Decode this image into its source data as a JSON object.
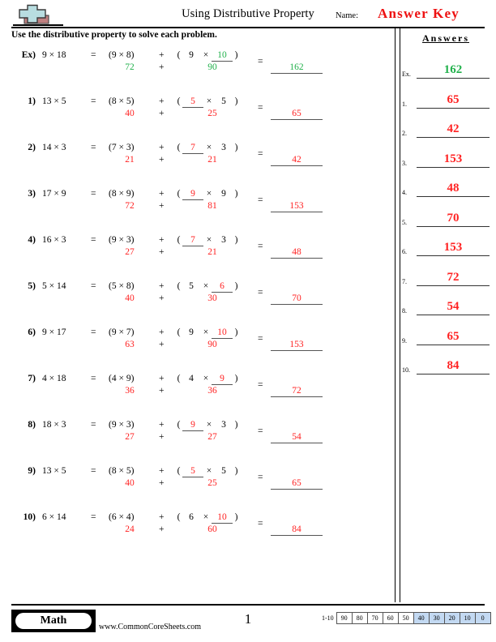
{
  "header": {
    "title": "Using Distributive Property",
    "name_label": "Name:",
    "answer_key": "Answer Key",
    "logo_icon": "plus-block-logo"
  },
  "instructions": "Use the distributive property to solve each problem.",
  "answers_panel": {
    "title": "Answers",
    "rows": [
      {
        "label": "Ex.",
        "value": "162",
        "color": "#22b14c"
      },
      {
        "label": "1.",
        "value": "65",
        "color": "#ff2222"
      },
      {
        "label": "2.",
        "value": "42",
        "color": "#ff2222"
      },
      {
        "label": "3.",
        "value": "153",
        "color": "#ff2222"
      },
      {
        "label": "4.",
        "value": "48",
        "color": "#ff2222"
      },
      {
        "label": "5.",
        "value": "70",
        "color": "#ff2222"
      },
      {
        "label": "6.",
        "value": "153",
        "color": "#ff2222"
      },
      {
        "label": "7.",
        "value": "72",
        "color": "#ff2222"
      },
      {
        "label": "8.",
        "value": "54",
        "color": "#ff2222"
      },
      {
        "label": "9.",
        "value": "65",
        "color": "#ff2222"
      },
      {
        "label": "10.",
        "value": "84",
        "color": "#ff2222"
      }
    ]
  },
  "problems": [
    {
      "number": "Ex)",
      "ink": "#22b14c",
      "expression": "9 × 18",
      "equals": "=",
      "group1": "(9 × 8)",
      "plus": "+",
      "group2": {
        "open": "(",
        "left": "9",
        "times": "×",
        "right": "10",
        "close": ")",
        "blank_side": "right"
      },
      "partial1": "72",
      "plus2": "+",
      "partial2": "90",
      "equals2": "=",
      "total": "162"
    },
    {
      "number": "1)",
      "ink": "#ff2222",
      "expression": "13 × 5",
      "equals": "=",
      "group1": "(8 × 5)",
      "plus": "+",
      "group2": {
        "open": "(",
        "left": "5",
        "times": "×",
        "right": "5",
        "close": ")",
        "blank_side": "left"
      },
      "partial1": "40",
      "plus2": "+",
      "partial2": "25",
      "equals2": "=",
      "total": "65"
    },
    {
      "number": "2)",
      "ink": "#ff2222",
      "expression": "14 × 3",
      "equals": "=",
      "group1": "(7 × 3)",
      "plus": "+",
      "group2": {
        "open": "(",
        "left": "7",
        "times": "×",
        "right": "3",
        "close": ")",
        "blank_side": "left"
      },
      "partial1": "21",
      "plus2": "+",
      "partial2": "21",
      "equals2": "=",
      "total": "42"
    },
    {
      "number": "3)",
      "ink": "#ff2222",
      "expression": "17 × 9",
      "equals": "=",
      "group1": "(8 × 9)",
      "plus": "+",
      "group2": {
        "open": "(",
        "left": "9",
        "times": "×",
        "right": "9",
        "close": ")",
        "blank_side": "left"
      },
      "partial1": "72",
      "plus2": "+",
      "partial2": "81",
      "equals2": "=",
      "total": "153"
    },
    {
      "number": "4)",
      "ink": "#ff2222",
      "expression": "16 × 3",
      "equals": "=",
      "group1": "(9 × 3)",
      "plus": "+",
      "group2": {
        "open": "(",
        "left": "7",
        "times": "×",
        "right": "3",
        "close": ")",
        "blank_side": "left"
      },
      "partial1": "27",
      "plus2": "+",
      "partial2": "21",
      "equals2": "=",
      "total": "48"
    },
    {
      "number": "5)",
      "ink": "#ff2222",
      "expression": "5 × 14",
      "equals": "=",
      "group1": "(5 × 8)",
      "plus": "+",
      "group2": {
        "open": "(",
        "left": "5",
        "times": "×",
        "right": "6",
        "close": ")",
        "blank_side": "right"
      },
      "partial1": "40",
      "plus2": "+",
      "partial2": "30",
      "equals2": "=",
      "total": "70"
    },
    {
      "number": "6)",
      "ink": "#ff2222",
      "expression": "9 × 17",
      "equals": "=",
      "group1": "(9 × 7)",
      "plus": "+",
      "group2": {
        "open": "(",
        "left": "9",
        "times": "×",
        "right": "10",
        "close": ")",
        "blank_side": "right"
      },
      "partial1": "63",
      "plus2": "+",
      "partial2": "90",
      "equals2": "=",
      "total": "153"
    },
    {
      "number": "7)",
      "ink": "#ff2222",
      "expression": "4 × 18",
      "equals": "=",
      "group1": "(4 × 9)",
      "plus": "+",
      "group2": {
        "open": "(",
        "left": "4",
        "times": "×",
        "right": "9",
        "close": ")",
        "blank_side": "right"
      },
      "partial1": "36",
      "plus2": "+",
      "partial2": "36",
      "equals2": "=",
      "total": "72"
    },
    {
      "number": "8)",
      "ink": "#ff2222",
      "expression": "18 × 3",
      "equals": "=",
      "group1": "(9 × 3)",
      "plus": "+",
      "group2": {
        "open": "(",
        "left": "9",
        "times": "×",
        "right": "3",
        "close": ")",
        "blank_side": "left"
      },
      "partial1": "27",
      "plus2": "+",
      "partial2": "27",
      "equals2": "=",
      "total": "54"
    },
    {
      "number": "9)",
      "ink": "#ff2222",
      "expression": "13 × 5",
      "equals": "=",
      "group1": "(8 × 5)",
      "plus": "+",
      "group2": {
        "open": "(",
        "left": "5",
        "times": "×",
        "right": "5",
        "close": ")",
        "blank_side": "left"
      },
      "partial1": "40",
      "plus2": "+",
      "partial2": "25",
      "equals2": "=",
      "total": "65"
    },
    {
      "number": "10)",
      "ink": "#ff2222",
      "expression": "6 × 14",
      "equals": "=",
      "group1": "(6 × 4)",
      "plus": "+",
      "group2": {
        "open": "(",
        "left": "6",
        "times": "×",
        "right": "10",
        "close": ")",
        "blank_side": "right"
      },
      "partial1": "24",
      "plus2": "+",
      "partial2": "60",
      "equals2": "=",
      "total": "84"
    }
  ],
  "footer": {
    "brand": "Math",
    "url": "www.CommonCoreSheets.com",
    "page_number": "1",
    "scale_label": "1-10",
    "scale_boxes": [
      {
        "value": "90",
        "highlighted": false
      },
      {
        "value": "80",
        "highlighted": false
      },
      {
        "value": "70",
        "highlighted": false
      },
      {
        "value": "60",
        "highlighted": false
      },
      {
        "value": "50",
        "highlighted": false
      },
      {
        "value": "40",
        "highlighted": true
      },
      {
        "value": "30",
        "highlighted": true
      },
      {
        "value": "20",
        "highlighted": true
      },
      {
        "value": "10",
        "highlighted": true
      },
      {
        "value": "0",
        "highlighted": true
      }
    ]
  }
}
